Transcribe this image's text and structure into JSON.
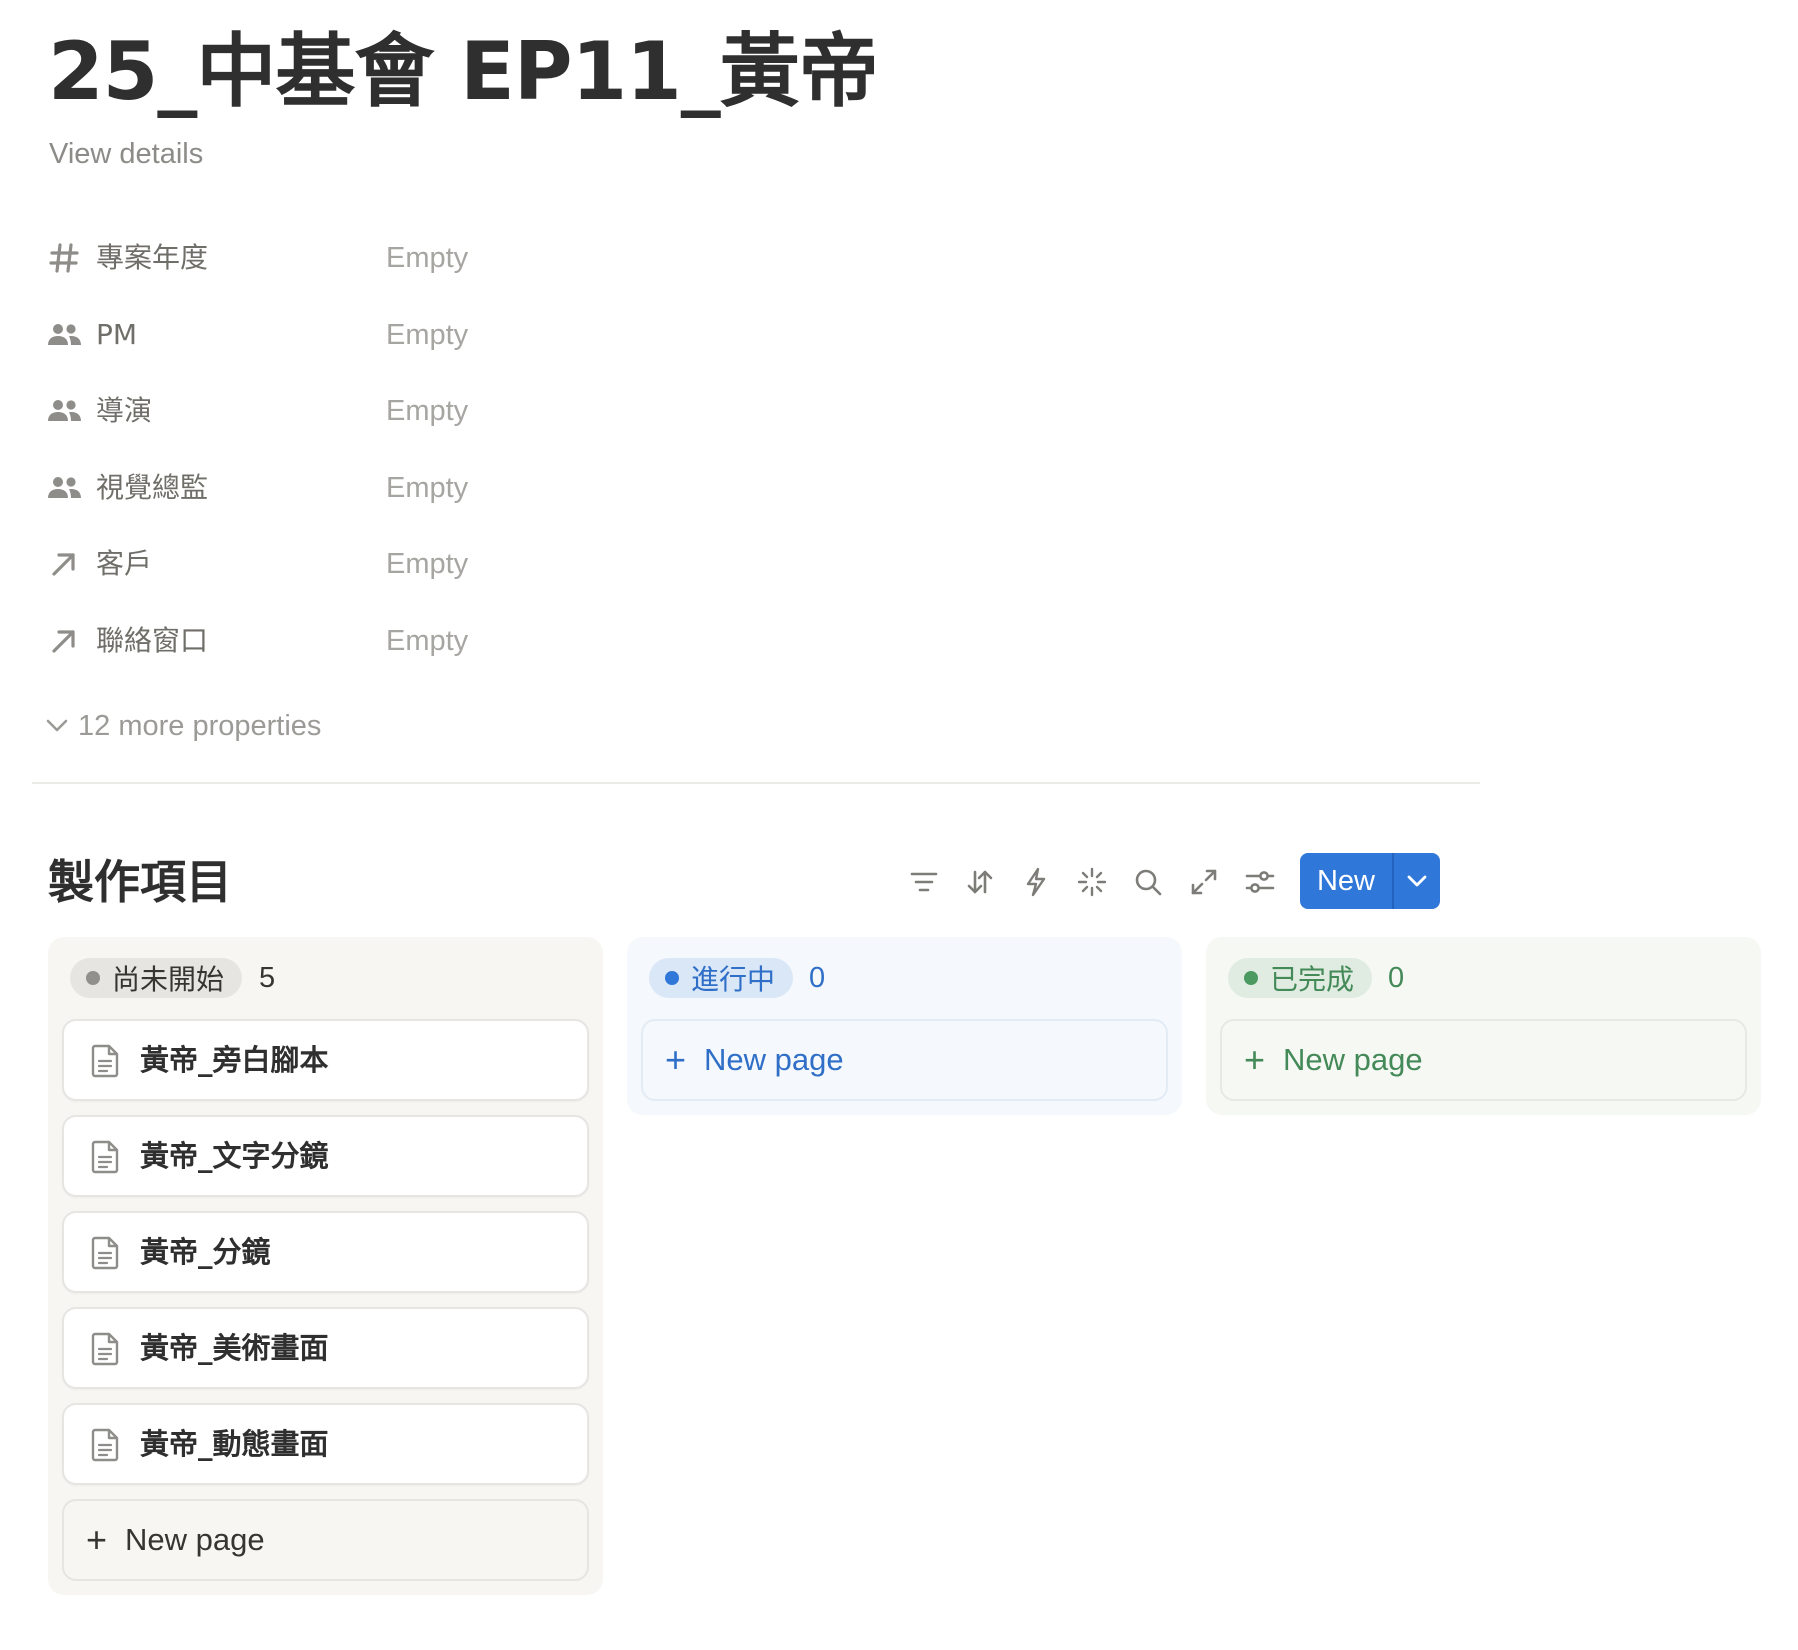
{
  "page": {
    "title": "25_中基會 EP11_黃帝",
    "view_details": "View details"
  },
  "properties": [
    {
      "icon": "hash-icon",
      "label": "專案年度",
      "value": "Empty"
    },
    {
      "icon": "people-icon",
      "label": "PM",
      "value": "Empty"
    },
    {
      "icon": "people-icon",
      "label": "導演",
      "value": "Empty"
    },
    {
      "icon": "people-icon",
      "label": "視覺總監",
      "value": "Empty"
    },
    {
      "icon": "relation-arrow-icon",
      "label": "客戶",
      "value": "Empty"
    },
    {
      "icon": "relation-arrow-icon",
      "label": "聯絡窗口",
      "value": "Empty"
    }
  ],
  "more_properties": "12 more properties",
  "database": {
    "title": "製作項目",
    "toolbar": [
      "filter-icon",
      "sort-icon",
      "automation-bolt-icon",
      "ai-sparkle-icon",
      "search-icon",
      "expand-icon",
      "settings-sliders-icon"
    ],
    "new_button": "New"
  },
  "columns": [
    {
      "status": "尚未開始",
      "count": "5",
      "bg": "#f7f6f3",
      "pill_bg": "#e6e5e2",
      "dot": "#91908c",
      "text": "#37352f",
      "cards": [
        "黃帝_旁白腳本",
        "黃帝_文字分鏡",
        "黃帝_分鏡",
        "黃帝_美術畫面",
        "黃帝_動態畫面"
      ],
      "new_page": "New page"
    },
    {
      "status": "進行中",
      "count": "0",
      "bg": "#f5f8fc",
      "pill_bg": "#d9e7f7",
      "dot": "#2f77d9",
      "text": "#2f6fc7",
      "cards": [],
      "new_page": "New page"
    },
    {
      "status": "已完成",
      "count": "0",
      "bg": "#f6f8f4",
      "pill_bg": "#e0ece2",
      "dot": "#4a9a62",
      "text": "#448a58",
      "cards": [],
      "new_page": "New page"
    }
  ]
}
